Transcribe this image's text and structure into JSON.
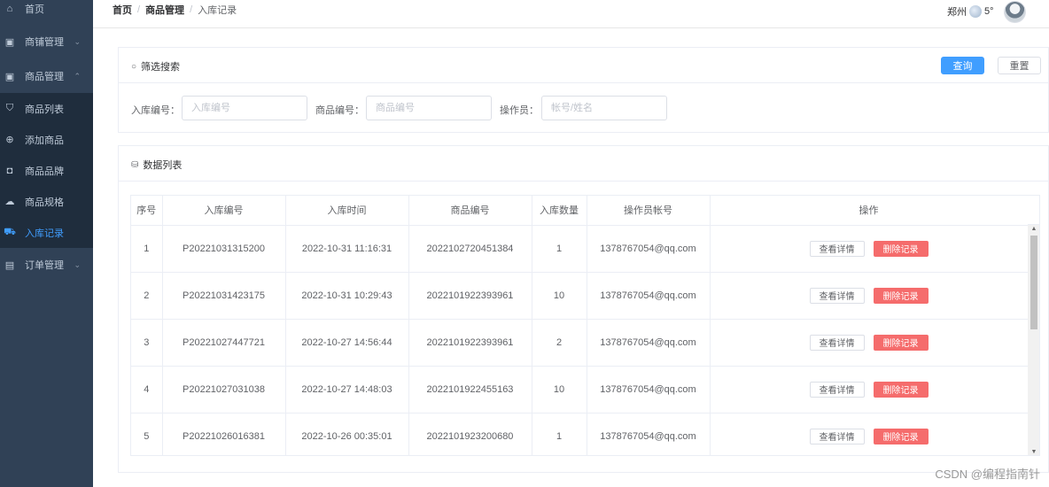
{
  "sidebar": {
    "items": [
      {
        "icon": "home-icon",
        "glyph": "⌂",
        "label": "首页",
        "chevron": ""
      },
      {
        "icon": "shop-icon",
        "glyph": "▣",
        "label": "商铺管理",
        "chevron": "⌄"
      },
      {
        "icon": "goods-icon",
        "glyph": "▣",
        "label": "商品管理",
        "chevron": "⌃"
      },
      {
        "icon": "goods-list-icon",
        "glyph": "⛉",
        "label": "商品列表",
        "chevron": ""
      },
      {
        "icon": "add-circle-icon",
        "glyph": "⊕",
        "label": "添加商品",
        "chevron": ""
      },
      {
        "icon": "brand-icon",
        "glyph": "◘",
        "label": "商品品牌",
        "chevron": ""
      },
      {
        "icon": "cloud-icon",
        "glyph": "☁",
        "label": "商品规格",
        "chevron": ""
      },
      {
        "icon": "truck-icon",
        "glyph": "⛟",
        "label": "入库记录",
        "chevron": ""
      },
      {
        "icon": "order-icon",
        "glyph": "▤",
        "label": "订单管理",
        "chevron": "⌄"
      }
    ]
  },
  "header": {
    "breadcrumb": [
      "首页",
      "商品管理",
      "入库记录"
    ],
    "city": "郑州",
    "temperature": "5°"
  },
  "filter": {
    "title": "筛选搜索",
    "search_label": "查询",
    "reset_label": "重置",
    "fields": [
      {
        "label": "入库编号：",
        "placeholder": "入库编号"
      },
      {
        "label": "商品编号：",
        "placeholder": "商品编号"
      },
      {
        "label": "操作员：",
        "placeholder": "帐号/姓名"
      }
    ]
  },
  "list": {
    "title": "数据列表",
    "columns": [
      "序号",
      "入库编号",
      "入库时间",
      "商品编号",
      "入库数量",
      "操作员帐号",
      "操作"
    ],
    "detail_label": "查看详情",
    "delete_label": "删除记录",
    "rows": [
      {
        "no": "1",
        "stock_id": "P20221031315200",
        "time": "2022-10-31 11:16:31",
        "goods_id": "2022102720451384",
        "qty": "1",
        "operator": "1378767054@qq.com"
      },
      {
        "no": "2",
        "stock_id": "P20221031423175",
        "time": "2022-10-31 10:29:43",
        "goods_id": "2022101922393961",
        "qty": "10",
        "operator": "1378767054@qq.com"
      },
      {
        "no": "3",
        "stock_id": "P20221027447721",
        "time": "2022-10-27 14:56:44",
        "goods_id": "2022101922393961",
        "qty": "2",
        "operator": "1378767054@qq.com"
      },
      {
        "no": "4",
        "stock_id": "P20221027031038",
        "time": "2022-10-27 14:48:03",
        "goods_id": "2022101922455163",
        "qty": "10",
        "operator": "1378767054@qq.com"
      },
      {
        "no": "5",
        "stock_id": "P20221026016381",
        "time": "2022-10-26 00:35:01",
        "goods_id": "2022101923200680",
        "qty": "1",
        "operator": "1378767054@qq.com"
      }
    ]
  },
  "watermark": "CSDN @编程指南针",
  "colors": {
    "sidebar_bg": "#304156",
    "primary": "#409eff",
    "danger": "#f56c6c"
  }
}
